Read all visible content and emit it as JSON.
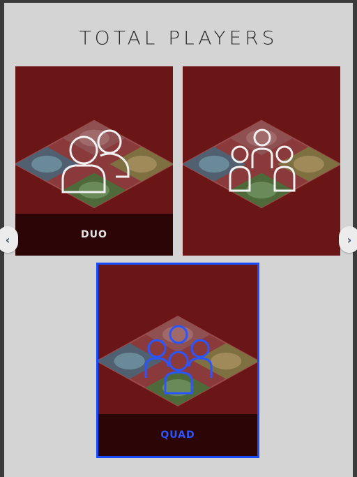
{
  "screen": {
    "title": "TOTAL PLAYERS"
  },
  "options": [
    {
      "id": "duo",
      "label": "DUO",
      "icon": "two-users-icon",
      "selected": false
    },
    {
      "id": "trio",
      "label": "",
      "icon": "three-users-icon",
      "selected": false
    },
    {
      "id": "quad",
      "label": "QUAD",
      "icon": "four-users-icon",
      "selected": true
    }
  ],
  "navigation": {
    "prev_icon": "chevron-left-icon",
    "prev_glyph": "‹",
    "next_icon": "chevron-right-icon",
    "next_glyph": "›"
  },
  "colors": {
    "card_background": "#6a1414",
    "selected_accent": "#1a4cff",
    "icon_default": "#f2f2f2",
    "icon_selected": "#2a55ff"
  }
}
